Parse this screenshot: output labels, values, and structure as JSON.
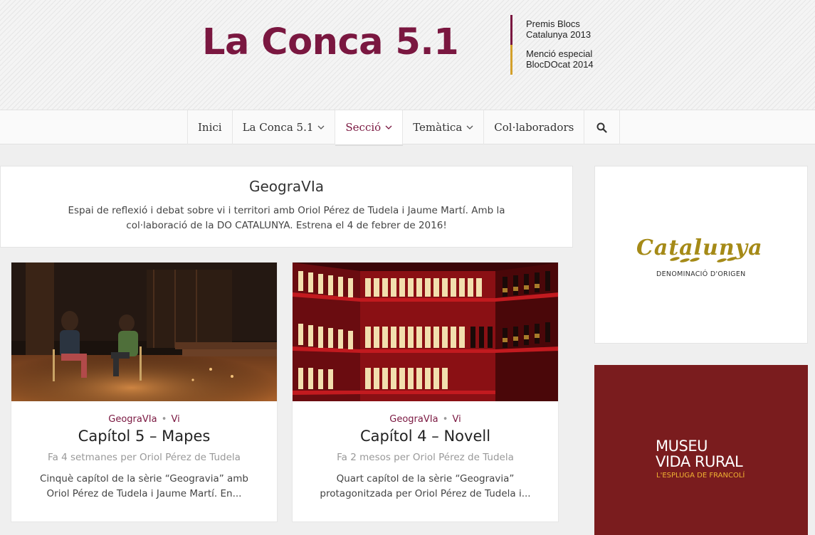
{
  "header": {
    "site_title": "La Conca 5.1",
    "awards": [
      {
        "line1": "Premis Blocs",
        "line2": "Catalunya 2013",
        "color": "#7a1740"
      },
      {
        "line1": "Menció especial",
        "line2": "BlocDOcat 2014",
        "color": "#d3a02b"
      }
    ]
  },
  "nav": {
    "items": [
      {
        "label": "Inici"
      },
      {
        "label": "La Conca 5.1"
      },
      {
        "label": "Secció"
      },
      {
        "label": "Temàtica"
      },
      {
        "label": "Col·laboradors"
      }
    ],
    "chevron": "⌄",
    "search_icon": "search-icon"
  },
  "intro": {
    "title": "GeograVIa",
    "description": "Espai de reflexió i debat sobre vi i territori amb Oriol Pérez de Tudela i Jaume Martí. Amb la col·laboració de la DO CATALUNYA. Estrena el 4 de febrer de 2016!"
  },
  "cards": [
    {
      "cat1": "GeograVIa",
      "sep": "•",
      "cat2": "Vi",
      "title": "Capítol 5 – Mapes",
      "meta": "Fa 4 setmanes per Oriol Pérez de Tudela",
      "excerpt": "Cinquè capítol de la sèrie “Geogravia” amb Oriol Pérez de Tudela i Jaume Martí. En..."
    },
    {
      "cat1": "GeograVIa",
      "sep": "•",
      "cat2": "Vi",
      "title": "Capítol 4 – Novell",
      "meta": "Fa 2 mesos per Oriol Pérez de Tudela",
      "excerpt": "Quart capítol de la sèrie “Geogravia” protagonitzada per Oriol Pérez de Tudela i..."
    }
  ],
  "sidebar": {
    "ad1": {
      "logo_text": "Catalunya",
      "subtitle": "DENOMINACIÓ D'ORIGEN"
    },
    "ad2": {
      "line1": "MUSEU",
      "line2": "VIDA RURAL",
      "line3": "L'ESPLUGA DE FRANCOLÍ"
    }
  },
  "colors": {
    "brand": "#7a1740",
    "gold": "#d3a02b",
    "museu": "#7a1c1e"
  }
}
